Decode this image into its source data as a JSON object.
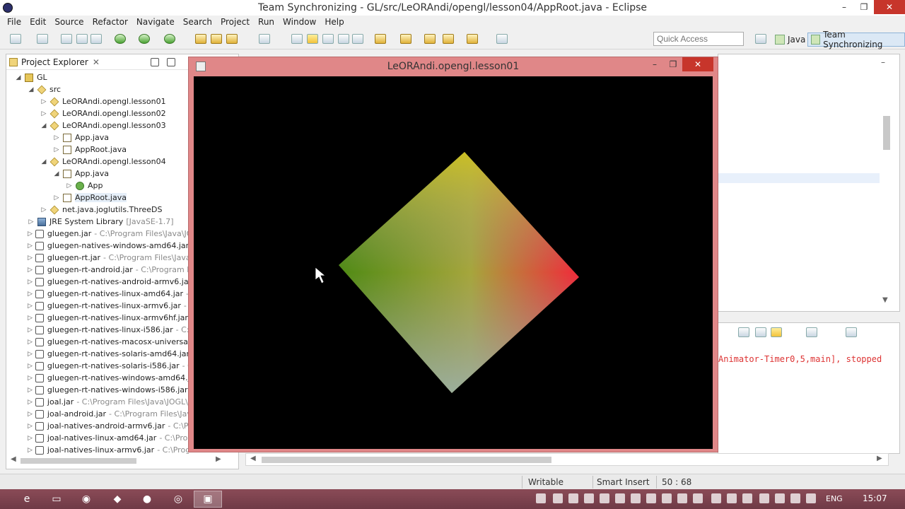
{
  "window": {
    "title": "Team Synchronizing - GL/src/LeORAndi/opengl/lesson04/AppRoot.java - Eclipse",
    "min": "–",
    "max": "❐",
    "close": "✕"
  },
  "menu": [
    "File",
    "Edit",
    "Source",
    "Refactor",
    "Navigate",
    "Search",
    "Project",
    "Run",
    "Window",
    "Help"
  ],
  "toolbar": {
    "quick_access_placeholder": "Quick Access",
    "perspective_java": "Java",
    "perspective_team": "Team Synchronizing"
  },
  "explorer": {
    "title": "Project Explorer",
    "close": "✕",
    "tree": [
      {
        "arrow": "◢",
        "icon": "proj",
        "label": "GL",
        "sub": ""
      },
      {
        "arrow": "◢",
        "icon": "pkg",
        "label": "src",
        "sub": ""
      },
      {
        "arrow": "▷",
        "icon": "pkg",
        "label": "LeORAndi.opengl.lesson01",
        "sub": ""
      },
      {
        "arrow": "▷",
        "icon": "pkg",
        "label": "LeORAndi.opengl.lesson02",
        "sub": ""
      },
      {
        "arrow": "◢",
        "icon": "pkg",
        "label": "LeORAndi.opengl.lesson03",
        "sub": ""
      },
      {
        "arrow": "▷",
        "icon": "java",
        "label": "App.java",
        "sub": ""
      },
      {
        "arrow": "▷",
        "icon": "java",
        "label": "AppRoot.java",
        "sub": ""
      },
      {
        "arrow": "◢",
        "icon": "pkg",
        "label": "LeORAndi.opengl.lesson04",
        "sub": ""
      },
      {
        "arrow": "◢",
        "icon": "java",
        "label": "App.java",
        "sub": ""
      },
      {
        "arrow": "▷",
        "icon": "cls",
        "label": "App",
        "sub": ""
      },
      {
        "arrow": "▷",
        "icon": "java",
        "label": "AppRoot.java",
        "sub": ""
      },
      {
        "arrow": "▷",
        "icon": "pkg",
        "label": "net.java.joglutils.ThreeDS",
        "sub": ""
      },
      {
        "arrow": "▷",
        "icon": "lib",
        "label": "JRE System Library",
        "sub": "[JavaSE-1.7]"
      },
      {
        "arrow": "▷",
        "icon": "jar",
        "label": "gluegen.jar",
        "sub": "- C:\\Program Files\\Java\\JOG"
      },
      {
        "arrow": "▷",
        "icon": "jar",
        "label": "gluegen-natives-windows-amd64.jar",
        "sub": "- C"
      },
      {
        "arrow": "▷",
        "icon": "jar",
        "label": "gluegen-rt.jar",
        "sub": "- C:\\Program Files\\Java\\J"
      },
      {
        "arrow": "▷",
        "icon": "jar",
        "label": "gluegen-rt-android.jar",
        "sub": "- C:\\Program File"
      },
      {
        "arrow": "▷",
        "icon": "jar",
        "label": "gluegen-rt-natives-android-armv6.jar",
        "sub": "-"
      },
      {
        "arrow": "▷",
        "icon": "jar",
        "label": "gluegen-rt-natives-linux-amd64.jar",
        "sub": "- C:"
      },
      {
        "arrow": "▷",
        "icon": "jar",
        "label": "gluegen-rt-natives-linux-armv6.jar",
        "sub": "- C:"
      },
      {
        "arrow": "▷",
        "icon": "jar",
        "label": "gluegen-rt-natives-linux-armv6hf.jar",
        "sub": "- C"
      },
      {
        "arrow": "▷",
        "icon": "jar",
        "label": "gluegen-rt-natives-linux-i586.jar",
        "sub": "- C:\\Pr"
      },
      {
        "arrow": "▷",
        "icon": "jar",
        "label": "gluegen-rt-natives-macosx-universal.jar",
        "sub": ""
      },
      {
        "arrow": "▷",
        "icon": "jar",
        "label": "gluegen-rt-natives-solaris-amd64.jar",
        "sub": "- C"
      },
      {
        "arrow": "▷",
        "icon": "jar",
        "label": "gluegen-rt-natives-solaris-i586.jar",
        "sub": "- C:\\P"
      },
      {
        "arrow": "▷",
        "icon": "jar",
        "label": "gluegen-rt-natives-windows-amd64.jar",
        "sub": ""
      },
      {
        "arrow": "▷",
        "icon": "jar",
        "label": "gluegen-rt-natives-windows-i586.jar",
        "sub": "- C"
      },
      {
        "arrow": "▷",
        "icon": "jar",
        "label": "joal.jar",
        "sub": "- C:\\Program Files\\Java\\JOGL\\jo"
      },
      {
        "arrow": "▷",
        "icon": "jar",
        "label": "joal-android.jar",
        "sub": "- C:\\Program Files\\Java\\"
      },
      {
        "arrow": "▷",
        "icon": "jar",
        "label": "joal-natives-android-armv6.jar",
        "sub": "- C:\\Pro"
      },
      {
        "arrow": "▷",
        "icon": "jar",
        "label": "joal-natives-linux-amd64.jar",
        "sub": "- C:\\Progra"
      },
      {
        "arrow": "▷",
        "icon": "jar",
        "label": "joal-natives-linux-armv6.jar",
        "sub": "- C:\\Progra"
      }
    ]
  },
  "gl_window": {
    "title": "LeORAndi.opengl.lesson01",
    "min": "–",
    "max": "❐",
    "close": "✕"
  },
  "console": {
    "text": "Animator-Timer0,5,main], stopped"
  },
  "status": {
    "writable": "Writable",
    "insert": "Smart Insert",
    "position": "50 : 68"
  },
  "taskbar": {
    "lang": "ENG",
    "time": "15:07"
  }
}
